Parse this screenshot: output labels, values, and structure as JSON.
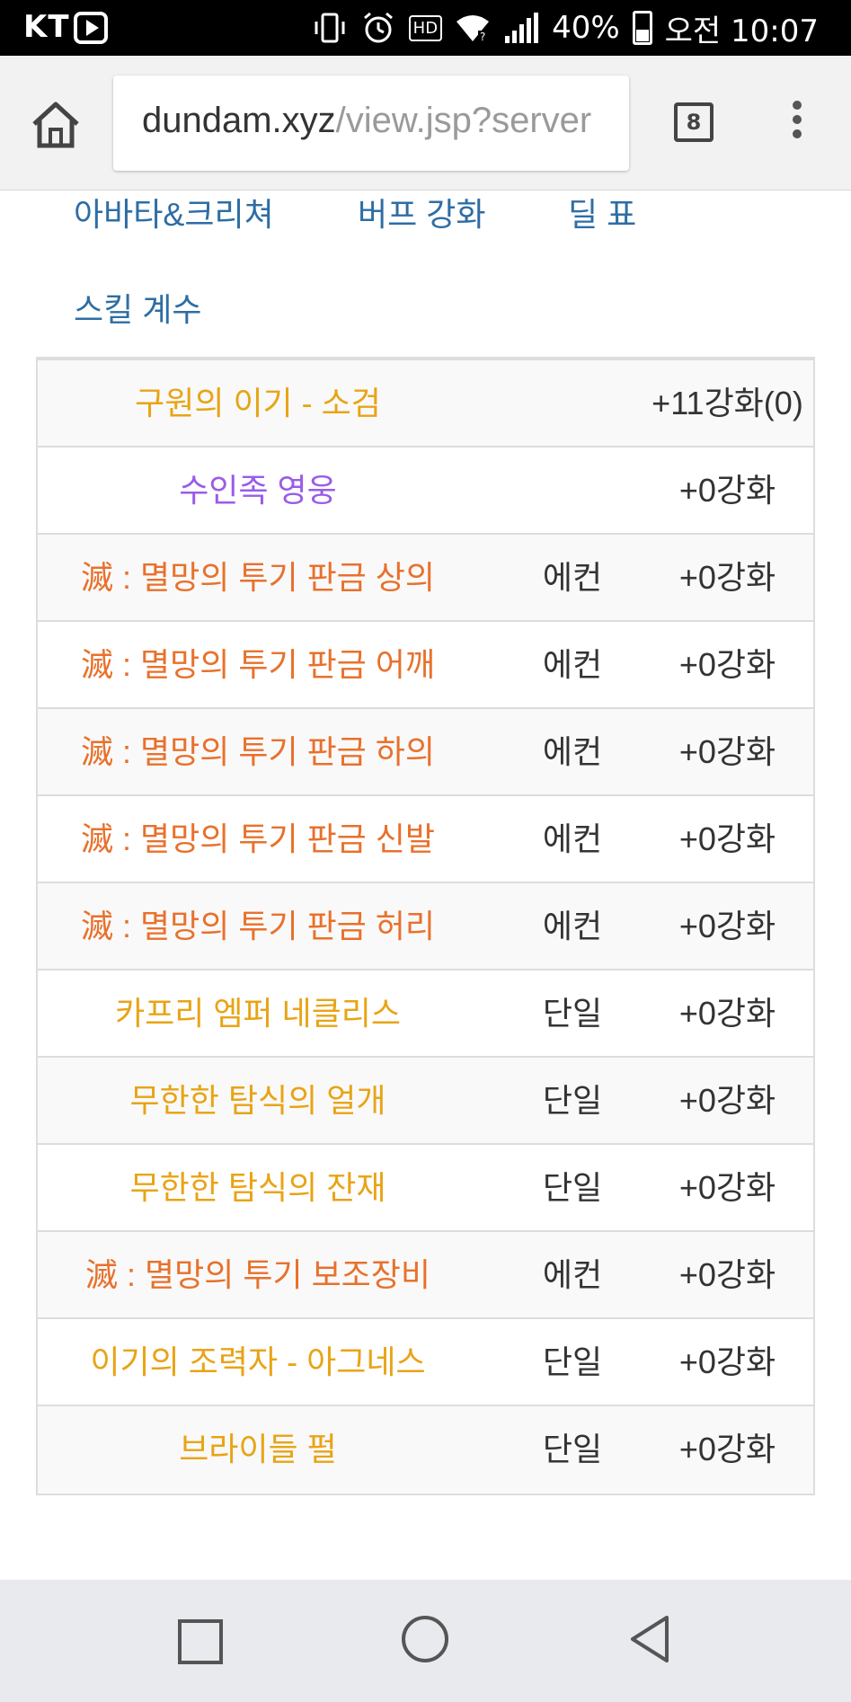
{
  "status_bar": {
    "carrier": "KT",
    "hd_label": "HD",
    "battery": "40%",
    "time": "오전 10:07"
  },
  "browser": {
    "url_host": "dundam.xyz",
    "url_path": "/view.jsp?server",
    "tab_count": "8"
  },
  "nav_links": [
    {
      "label": "아바타&크리쳐"
    },
    {
      "label": "버프 강화"
    },
    {
      "label": "딜 표"
    },
    {
      "label": "스킬 계수"
    }
  ],
  "equipment": {
    "colors": {
      "epic": "#e8a416",
      "legendary": "#9a5ce8",
      "myth": "#e8712c"
    },
    "rows": [
      {
        "name": "구원의 이기 - 소검",
        "type": "",
        "enhance": "+11강화(0)",
        "color": "#e8a416"
      },
      {
        "name": "수인족 영웅",
        "type": "",
        "enhance": "+0강화",
        "color": "#9a5ce8"
      },
      {
        "name": "滅 : 멸망의 투기 판금 상의",
        "type": "에컨",
        "enhance": "+0강화",
        "color": "#e8712c"
      },
      {
        "name": "滅 : 멸망의 투기 판금 어깨",
        "type": "에컨",
        "enhance": "+0강화",
        "color": "#e8712c"
      },
      {
        "name": "滅 : 멸망의 투기 판금 하의",
        "type": "에컨",
        "enhance": "+0강화",
        "color": "#e8712c"
      },
      {
        "name": "滅 : 멸망의 투기 판금 신발",
        "type": "에컨",
        "enhance": "+0강화",
        "color": "#e8712c"
      },
      {
        "name": "滅 : 멸망의 투기 판금 허리",
        "type": "에컨",
        "enhance": "+0강화",
        "color": "#e8712c"
      },
      {
        "name": "카프리 엠퍼 네클리스",
        "type": "단일",
        "enhance": "+0강화",
        "color": "#e8a416"
      },
      {
        "name": "무한한 탐식의 얼개",
        "type": "단일",
        "enhance": "+0강화",
        "color": "#e8a416"
      },
      {
        "name": "무한한 탐식의 잔재",
        "type": "단일",
        "enhance": "+0강화",
        "color": "#e8a416"
      },
      {
        "name": "滅 : 멸망의 투기 보조장비",
        "type": "에컨",
        "enhance": "+0강화",
        "color": "#e8712c"
      },
      {
        "name": "이기의 조력자 - 아그네스",
        "type": "단일",
        "enhance": "+0강화",
        "color": "#e8a416"
      },
      {
        "name": "브라이들 펄",
        "type": "단일",
        "enhance": "+0강화",
        "color": "#e8a416"
      }
    ]
  },
  "icons": {
    "status": [
      "play-icon",
      "vibrate-icon",
      "alarm-icon",
      "hd-icon",
      "wifi-icon",
      "signal-icon",
      "battery-icon"
    ],
    "browser": [
      "home-icon",
      "tabs-icon",
      "menu-icon"
    ],
    "nav": [
      "recent-apps-icon",
      "home-circle-icon",
      "back-icon"
    ]
  }
}
